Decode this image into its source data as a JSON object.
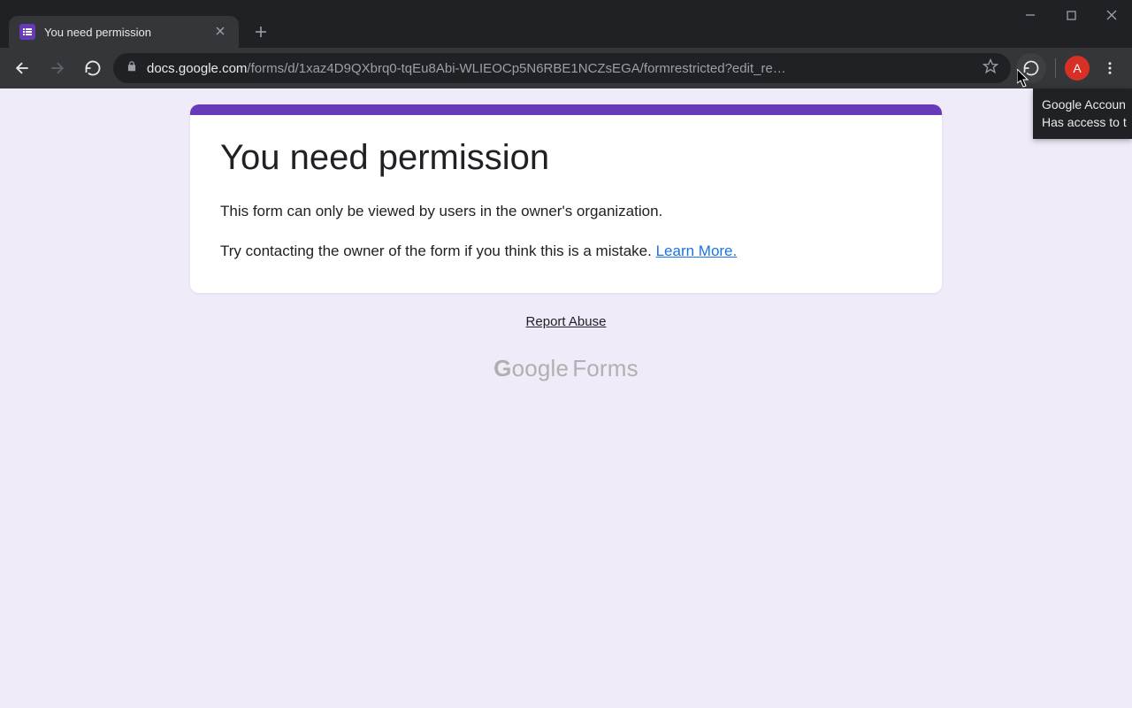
{
  "window": {
    "tab_title": "You need permission"
  },
  "addressbar": {
    "host": "docs.google.com",
    "path": "/forms/d/1xaz4D9QXbrq0-tqEu8Abi-WLIEOCp5N6RBE1NCZsEGA/formrestricted?edit_re…"
  },
  "avatar": {
    "initial": "A",
    "color": "#d93025"
  },
  "tooltip": {
    "line1": "Google Accoun",
    "line2": "Has access to t"
  },
  "page": {
    "heading": "You need permission",
    "body1": "This form can only be viewed by users in the owner's organization.",
    "body2_prefix": "Try contacting the owner of the form if you think this is a mistake. ",
    "learn_more": "Learn More.",
    "report_abuse": "Report Abuse",
    "brand_google": "Google",
    "brand_forms": "Forms"
  }
}
